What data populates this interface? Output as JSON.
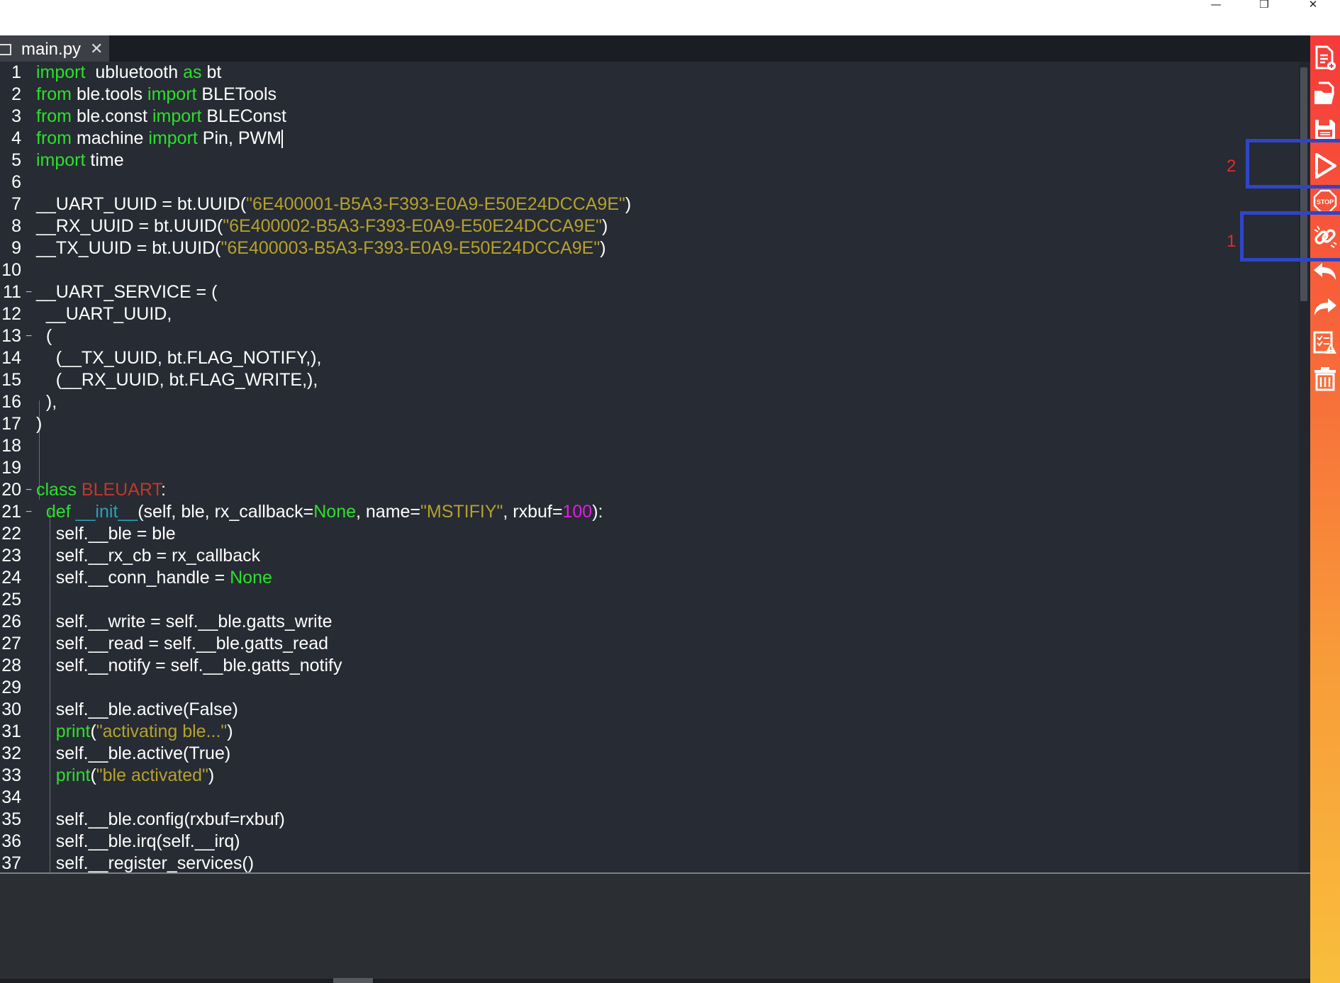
{
  "window": {
    "minimize_glyph": "—",
    "restore_glyph": "❐",
    "close_glyph": "✕"
  },
  "tab": {
    "label": "main.py",
    "close_glyph": "✕"
  },
  "code_colors": {
    "keyword": "#2ce02c",
    "string": "#b5a12e",
    "class_name": "#c0392b",
    "dunder": "#2aa1b5",
    "number": "#e31ce6"
  },
  "annotations": {
    "marker_1": "1",
    "marker_2": "2",
    "box_color": "#2f45c8",
    "marker_color": "#e52b2b"
  },
  "toolbar": [
    {
      "name": "new-file",
      "icon": "new-file-icon"
    },
    {
      "name": "open-file",
      "icon": "open-folder-icon"
    },
    {
      "name": "save-file",
      "icon": "save-icon"
    },
    {
      "name": "run",
      "icon": "play-icon"
    },
    {
      "name": "stop",
      "icon": "stop-icon",
      "label": "STOP"
    },
    {
      "name": "connect",
      "icon": "connect-link-icon"
    },
    {
      "name": "undo",
      "icon": "undo-icon"
    },
    {
      "name": "redo",
      "icon": "redo-icon"
    },
    {
      "name": "syntax-check",
      "icon": "syntax-check-icon"
    },
    {
      "name": "clear",
      "icon": "trash-icon"
    }
  ],
  "sidebar_gradient": [
    "#f53a3a",
    "#f89a3a",
    "#f9be3c"
  ],
  "lines": [
    {
      "n": "1",
      "t": [
        [
          "kw",
          "import"
        ],
        [
          "",
          "  ubluetooth "
        ],
        [
          "kw",
          "as"
        ],
        [
          "",
          " bt"
        ]
      ]
    },
    {
      "n": "2",
      "t": [
        [
          "kw",
          "from"
        ],
        [
          "",
          " ble.tools "
        ],
        [
          "kw",
          "import"
        ],
        [
          "",
          " BLETools"
        ]
      ]
    },
    {
      "n": "3",
      "t": [
        [
          "kw",
          "from"
        ],
        [
          "",
          " ble.const "
        ],
        [
          "kw",
          "import"
        ],
        [
          "",
          " BLEConst"
        ]
      ]
    },
    {
      "n": "4",
      "t": [
        [
          "kw",
          "from"
        ],
        [
          "",
          " machine "
        ],
        [
          "kw",
          "import"
        ],
        [
          "",
          " Pin, PWM"
        ]
      ],
      "cursor": true
    },
    {
      "n": "5",
      "t": [
        [
          "kw",
          "import"
        ],
        [
          "",
          " time"
        ]
      ]
    },
    {
      "n": "6",
      "t": []
    },
    {
      "n": "7",
      "t": [
        [
          "",
          "__UART_UUID = bt.UUID("
        ],
        [
          "str",
          "\"6E400001-B5A3-F393-E0A9-E50E24DCCA9E\""
        ],
        [
          "",
          ")"
        ]
      ]
    },
    {
      "n": "8",
      "t": [
        [
          "",
          "__RX_UUID = bt.UUID("
        ],
        [
          "str",
          "\"6E400002-B5A3-F393-E0A9-E50E24DCCA9E\""
        ],
        [
          "",
          ")"
        ]
      ]
    },
    {
      "n": "9",
      "t": [
        [
          "",
          "__TX_UUID = bt.UUID("
        ],
        [
          "str",
          "\"6E400003-B5A3-F393-E0A9-E50E24DCCA9E\""
        ],
        [
          "",
          ")"
        ]
      ]
    },
    {
      "n": "10",
      "t": []
    },
    {
      "n": "11",
      "t": [
        [
          "",
          "__UART_SERVICE = ("
        ]
      ],
      "fold": true
    },
    {
      "n": "12",
      "t": [
        [
          "",
          "  __UART_UUID,"
        ]
      ]
    },
    {
      "n": "13",
      "t": [
        [
          "",
          "  ("
        ]
      ],
      "fold": true
    },
    {
      "n": "14",
      "t": [
        [
          "",
          "    (__TX_UUID, bt.FLAG_NOTIFY,),"
        ]
      ]
    },
    {
      "n": "15",
      "t": [
        [
          "",
          "    (__RX_UUID, bt.FLAG_WRITE,),"
        ]
      ]
    },
    {
      "n": "16",
      "t": [
        [
          "",
          "  ),"
        ]
      ]
    },
    {
      "n": "17",
      "t": [
        [
          "",
          ")"
        ]
      ]
    },
    {
      "n": "18",
      "t": []
    },
    {
      "n": "19",
      "t": []
    },
    {
      "n": "20",
      "t": [
        [
          "kw",
          "class"
        ],
        [
          "",
          " "
        ],
        [
          "cls",
          "BLEUART"
        ],
        [
          "",
          ":"
        ]
      ],
      "fold": true
    },
    {
      "n": "21",
      "t": [
        [
          "",
          "  "
        ],
        [
          "kw",
          "def"
        ],
        [
          "",
          " "
        ],
        [
          "fn",
          "__init__"
        ],
        [
          "",
          "(self, ble, rx_callback="
        ],
        [
          "kw",
          "None"
        ],
        [
          "",
          ", name="
        ],
        [
          "str",
          "\"MSTIFIY\""
        ],
        [
          "",
          ", rxbuf="
        ],
        [
          "num",
          "100"
        ],
        [
          "",
          "):"
        ]
      ],
      "fold": true
    },
    {
      "n": "22",
      "t": [
        [
          "",
          "    self.__ble = ble"
        ]
      ]
    },
    {
      "n": "23",
      "t": [
        [
          "",
          "    self.__rx_cb = rx_callback"
        ]
      ]
    },
    {
      "n": "24",
      "t": [
        [
          "",
          "    self.__conn_handle = "
        ],
        [
          "kw",
          "None"
        ]
      ]
    },
    {
      "n": "25",
      "t": []
    },
    {
      "n": "26",
      "t": [
        [
          "",
          "    self.__write = self.__ble.gatts_write"
        ]
      ]
    },
    {
      "n": "27",
      "t": [
        [
          "",
          "    self.__read = self.__ble.gatts_read"
        ]
      ]
    },
    {
      "n": "28",
      "t": [
        [
          "",
          "    self.__notify = self.__ble.gatts_notify"
        ]
      ]
    },
    {
      "n": "29",
      "t": []
    },
    {
      "n": "30",
      "t": [
        [
          "",
          "    self.__ble.active(False)"
        ]
      ]
    },
    {
      "n": "31",
      "t": [
        [
          "",
          "    "
        ],
        [
          "kw",
          "print"
        ],
        [
          "",
          "("
        ],
        [
          "str",
          "\"activating ble...\""
        ],
        [
          "",
          ")"
        ]
      ]
    },
    {
      "n": "32",
      "t": [
        [
          "",
          "    self.__ble.active(True)"
        ]
      ]
    },
    {
      "n": "33",
      "t": [
        [
          "",
          "    "
        ],
        [
          "kw",
          "print"
        ],
        [
          "",
          "("
        ],
        [
          "str",
          "\"ble activated\""
        ],
        [
          "",
          ")"
        ]
      ]
    },
    {
      "n": "34",
      "t": []
    },
    {
      "n": "35",
      "t": [
        [
          "",
          "    self.__ble.config(rxbuf=rxbuf)"
        ]
      ]
    },
    {
      "n": "36",
      "t": [
        [
          "",
          "    self.__ble.irq(self.__irq)"
        ]
      ]
    },
    {
      "n": "37",
      "t": [
        [
          "",
          "    self.__register_services()"
        ]
      ]
    }
  ]
}
